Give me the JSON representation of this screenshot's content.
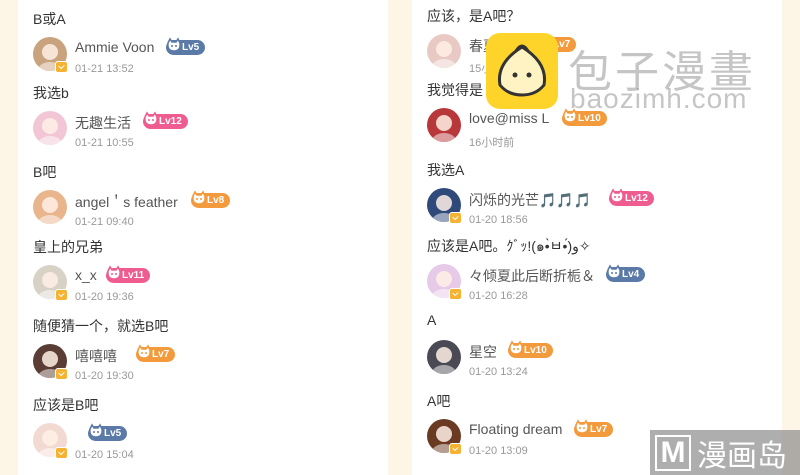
{
  "left": [
    {
      "text": "B或A",
      "user": "Ammie Voon",
      "time": "01-21 13:52",
      "level": "Lv5",
      "level_color": "blue",
      "badge": true
    },
    {
      "text": "我选b",
      "user": "无趣生活",
      "time": "01-21 10:55",
      "level": "Lv12",
      "level_color": "pink",
      "badge": false
    },
    {
      "text": "B吧",
      "user": "angel＇s feather",
      "time": "01-21 09:40",
      "level": "Lv8",
      "level_color": "orange",
      "badge": false
    },
    {
      "text": "皇上的兄弟",
      "user": "x_x",
      "time": "01-20 19:36",
      "level": "Lv11",
      "level_color": "pink",
      "badge": true
    },
    {
      "text": "随便猜一个，就选B吧",
      "user": "嘻嘻嘻",
      "time": "01-20 19:30",
      "level": "Lv7",
      "level_color": "orange",
      "badge": true
    },
    {
      "text": "应该是B吧",
      "user": "",
      "time": "01-20 15:04",
      "level": "Lv5",
      "level_color": "blue",
      "badge": true
    }
  ],
  "right": [
    {
      "text": "应该，是A吧？",
      "user": "春夏秋冬",
      "time": "15小时前",
      "level": "Lv7",
      "level_color": "orange",
      "badge": false
    },
    {
      "text": "我觉得是",
      "user": "love@miss  L",
      "time": "16小时前",
      "level": "Lv10",
      "level_color": "orange",
      "badge": false
    },
    {
      "text": "我选A",
      "user": "闪烁的光芒🎵🎵🎵",
      "time": "01-20 18:56",
      "level": "Lv12",
      "level_color": "pink",
      "badge": true
    },
    {
      "text": "应该是A吧。ｸﾞｯ!(๑•̀ㅂ•́)و✧",
      "user": "々倾夏此后断折栀＆",
      "time": "01-20 16:28",
      "level": "Lv4",
      "level_color": "blue",
      "badge": true
    },
    {
      "text": "A",
      "user": "星空",
      "time": "01-20 13:24",
      "level": "Lv10",
      "level_color": "orange",
      "badge": false
    },
    {
      "text": "A吧",
      "user": "Floating dream",
      "time": "01-20 13:09",
      "level": "Lv7",
      "level_color": "orange",
      "badge": true
    }
  ],
  "watermark": {
    "title": "包子漫畫",
    "url": "baozimh.com",
    "bottom_letter": "M",
    "bottom_text": "漫画岛"
  },
  "colors": {
    "pink": "#ef5c8f",
    "orange": "#f39a3d",
    "blue": "#5b7aa8",
    "badge": "#f5b233"
  }
}
